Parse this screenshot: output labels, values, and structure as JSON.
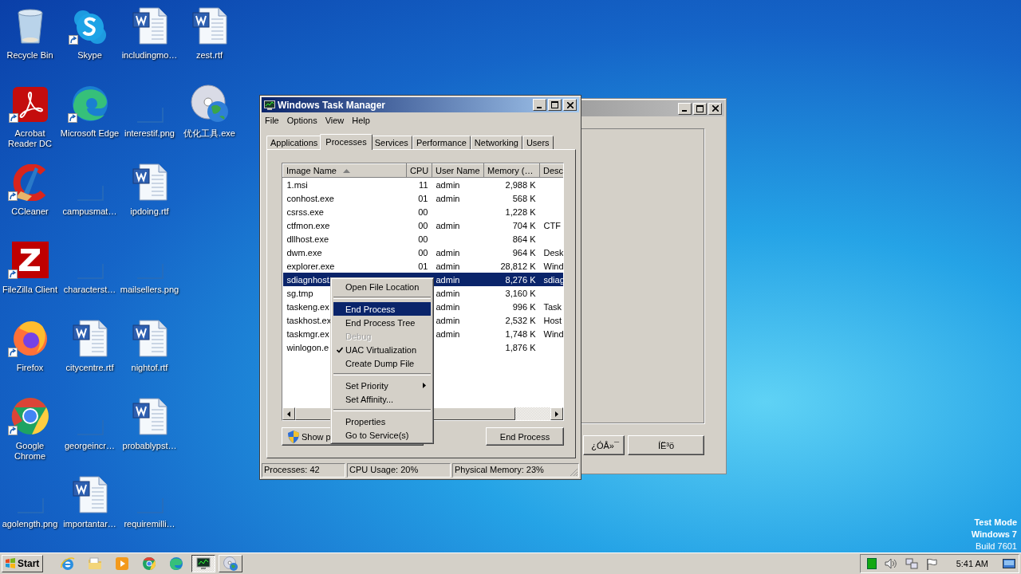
{
  "desktop_icons": [
    {
      "label": "Recycle Bin",
      "kind": "recycle",
      "shortcut": false
    },
    {
      "label": "Acrobat\nReader DC",
      "kind": "acrobat",
      "shortcut": true
    },
    {
      "label": "CCleaner",
      "kind": "ccleaner",
      "shortcut": true
    },
    {
      "label": "FileZilla Client",
      "kind": "filezilla",
      "shortcut": true
    },
    {
      "label": "Firefox",
      "kind": "firefox",
      "shortcut": true
    },
    {
      "label": "Google\nChrome",
      "kind": "chrome",
      "shortcut": true
    },
    {
      "label": "agolength.png",
      "kind": "blank",
      "shortcut": false
    },
    {
      "label": "Skype",
      "kind": "skype",
      "shortcut": true
    },
    {
      "label": "Microsoft Edge",
      "kind": "edge",
      "shortcut": true
    },
    {
      "label": "campusmat…",
      "kind": "blank",
      "shortcut": false
    },
    {
      "label": "characterst…",
      "kind": "blank",
      "shortcut": false
    },
    {
      "label": "citycentre.rtf",
      "kind": "word",
      "shortcut": false
    },
    {
      "label": "georgeincr…",
      "kind": "blank",
      "shortcut": false
    },
    {
      "label": "importantar…",
      "kind": "word",
      "shortcut": false
    },
    {
      "label": "includingmo…",
      "kind": "word",
      "shortcut": false
    },
    {
      "label": "interestif.png",
      "kind": "blank",
      "shortcut": false
    },
    {
      "label": "ipdoing.rtf",
      "kind": "word",
      "shortcut": false
    },
    {
      "label": "mailsellers.png",
      "kind": "blank",
      "shortcut": false
    },
    {
      "label": "nightof.rtf",
      "kind": "word",
      "shortcut": false
    },
    {
      "label": "probablypst…",
      "kind": "word",
      "shortcut": false
    },
    {
      "label": "requiremilli…",
      "kind": "blank",
      "shortcut": false
    },
    {
      "label": "zest.rtf",
      "kind": "word",
      "shortcut": false
    },
    {
      "label": "优化工具.exe",
      "kind": "cd",
      "shortcut": false
    }
  ],
  "background_window": {
    "buttons": [
      "¿ÓÅ»¯",
      "ÍË³ö"
    ]
  },
  "task_manager": {
    "title": "Windows Task Manager",
    "menu": [
      "File",
      "Options",
      "View",
      "Help"
    ],
    "tabs": [
      {
        "label": "Applications",
        "selected": false
      },
      {
        "label": "Processes",
        "selected": true
      },
      {
        "label": "Services",
        "selected": false
      },
      {
        "label": "Performance",
        "selected": false
      },
      {
        "label": "Networking",
        "selected": false
      },
      {
        "label": "Users",
        "selected": false
      }
    ],
    "columns": [
      {
        "label": "Image Name",
        "sorted": true
      },
      {
        "label": "CPU",
        "sorted": false
      },
      {
        "label": "User Name",
        "sorted": false
      },
      {
        "label": "Memory (…",
        "sorted": false
      },
      {
        "label": "Desc",
        "sorted": false
      }
    ],
    "rows": [
      {
        "image_name": "1.msi",
        "cpu": "11",
        "user_name": "admin",
        "memory": "2,988 K",
        "selected": false
      },
      {
        "image_name": "conhost.exe",
        "cpu": "01",
        "user_name": "admin",
        "memory": "568 K",
        "selected": false
      },
      {
        "image_name": "csrss.exe",
        "cpu": "00",
        "memory": "1,228 K",
        "selected": false
      },
      {
        "image_name": "ctfmon.exe",
        "cpu": "00",
        "user_name": "admin",
        "memory": "704 K",
        "description": "CTF",
        "selected": false
      },
      {
        "image_name": "dllhost.exe",
        "cpu": "00",
        "memory": "864 K",
        "selected": false
      },
      {
        "image_name": "dwm.exe",
        "cpu": "00",
        "user_name": "admin",
        "memory": "964 K",
        "description": "Desk",
        "selected": false
      },
      {
        "image_name": "explorer.exe",
        "cpu": "01",
        "user_name": "admin",
        "memory": "28,812 K",
        "description": "Wind",
        "selected": false
      },
      {
        "image_name": "sdiagnhost.",
        "user_name": "admin",
        "memory": "8,276 K",
        "description": "sdiag",
        "selected": true
      },
      {
        "image_name": "sg.tmp",
        "user_name": "admin",
        "memory": "3,160 K",
        "selected": false
      },
      {
        "image_name": "taskeng.ex",
        "user_name": "admin",
        "memory": "996 K",
        "description": "Task",
        "selected": false
      },
      {
        "image_name": "taskhost.ex",
        "user_name": "admin",
        "memory": "2,532 K",
        "description": "Host",
        "selected": false
      },
      {
        "image_name": "taskmgr.ex",
        "user_name": "admin",
        "memory": "1,748 K",
        "description": "Wind",
        "selected": false
      },
      {
        "image_name": "winlogon.e",
        "memory": "1,876 K",
        "selected": false
      }
    ],
    "show_button": "Show p",
    "end_button": "End Process",
    "status": [
      "Processes: 42",
      "CPU Usage: 20%",
      "Physical Memory: 23%"
    ]
  },
  "context_menu": [
    {
      "kind": "item",
      "label": "Open File Location",
      "selected": false,
      "disabled": false,
      "checked": false,
      "submenu": false
    },
    {
      "kind": "separator"
    },
    {
      "kind": "item",
      "label": "End Process",
      "selected": true,
      "disabled": false,
      "checked": false,
      "submenu": false
    },
    {
      "kind": "item",
      "label": "End Process Tree",
      "selected": false,
      "disabled": false,
      "checked": false,
      "submenu": false
    },
    {
      "kind": "item",
      "label": "Debug",
      "selected": false,
      "disabled": true,
      "checked": false,
      "submenu": false
    },
    {
      "kind": "item",
      "label": "UAC Virtualization",
      "selected": false,
      "disabled": false,
      "checked": true,
      "submenu": false
    },
    {
      "kind": "item",
      "label": "Create Dump File",
      "selected": false,
      "disabled": false,
      "checked": false,
      "submenu": false
    },
    {
      "kind": "separator"
    },
    {
      "kind": "item",
      "label": "Set Priority",
      "selected": false,
      "disabled": false,
      "checked": false,
      "submenu": true
    },
    {
      "kind": "item",
      "label": "Set Affinity...",
      "selected": false,
      "disabled": false,
      "checked": false,
      "submenu": false
    },
    {
      "kind": "separator"
    },
    {
      "kind": "item",
      "label": "Properties",
      "selected": false,
      "disabled": false,
      "checked": false,
      "submenu": false
    },
    {
      "kind": "item",
      "label": "Go to Service(s)",
      "selected": false,
      "disabled": false,
      "checked": false,
      "submenu": false
    }
  ],
  "system_notice": [
    "Test Mode",
    "Windows 7",
    "Build 7601"
  ],
  "taskbar": {
    "start": "Start",
    "apps": [
      {
        "kind": "ie",
        "active": false,
        "running": false
      },
      {
        "kind": "folder",
        "active": false,
        "running": false
      },
      {
        "kind": "media",
        "active": false,
        "running": false
      },
      {
        "kind": "chrome",
        "active": false,
        "running": false
      },
      {
        "kind": "edge",
        "active": false,
        "running": false
      },
      {
        "kind": "taskmgr",
        "active": true,
        "running": true
      },
      {
        "kind": "cd",
        "active": false,
        "running": true
      }
    ],
    "clock": "5:41 AM"
  }
}
